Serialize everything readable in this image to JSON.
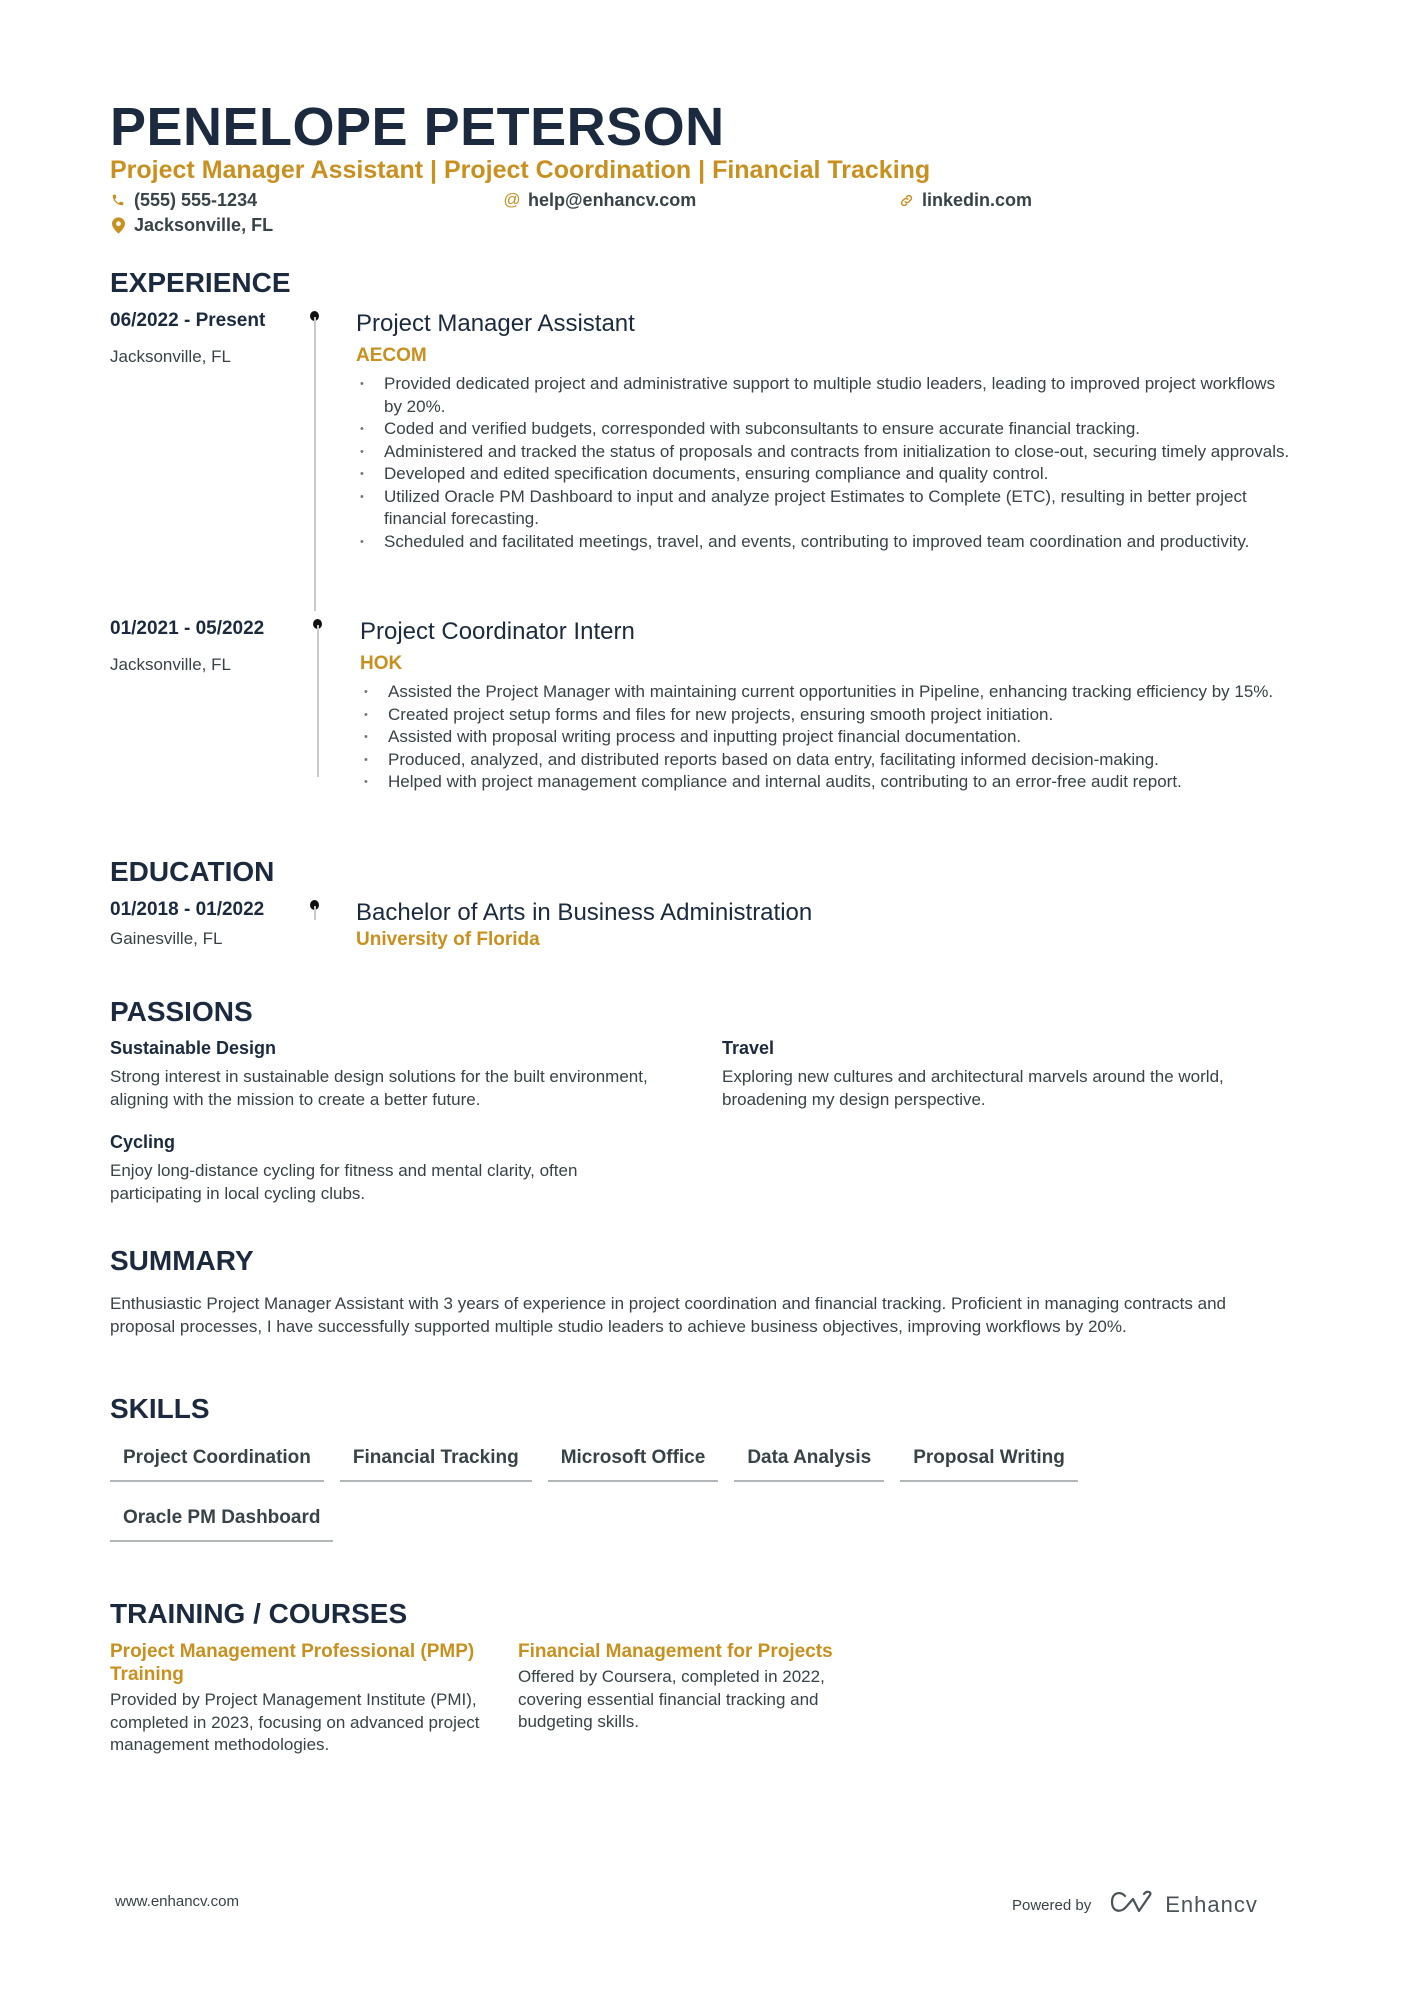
{
  "header": {
    "name": "PENELOPE PETERSON",
    "headline": "Project Manager Assistant | Project Coordination | Financial Tracking",
    "contacts": {
      "phone": {
        "icon": "phone-icon",
        "value": "(555) 555-1234"
      },
      "email": {
        "icon": "at-icon",
        "value": "help@enhancv.com"
      },
      "link": {
        "icon": "link-icon",
        "value": "linkedin.com"
      },
      "location": {
        "icon": "map-pin-icon",
        "value": "Jacksonville, FL"
      }
    }
  },
  "colors": {
    "accent": "#c9901f",
    "heading": "#1b2a3e",
    "body": "#384347"
  },
  "sections": {
    "experience": "EXPERIENCE",
    "education": "EDUCATION",
    "passions": "PASSIONS",
    "summary": "SUMMARY",
    "skills": "SKILLS",
    "training": "TRAINING / COURSES"
  },
  "experience": [
    {
      "date": "06/2022 - Present",
      "location": "Jacksonville, FL",
      "role": "Project Manager Assistant",
      "company": "AECOM",
      "bullets": [
        "Provided dedicated project and administrative support to multiple studio leaders, leading to improved project workflows by 20%.",
        "Coded and verified budgets, corresponded with subconsultants to ensure accurate financial tracking.",
        "Administered and tracked the status of proposals and contracts from initialization to close-out, securing timely approvals.",
        "Developed and edited specification documents, ensuring compliance and quality control.",
        "Utilized Oracle PM Dashboard to input and analyze project Estimates to Complete (ETC), resulting in better project financial forecasting.",
        "Scheduled and facilitated meetings, travel, and events, contributing to improved team coordination and productivity."
      ]
    },
    {
      "date": "01/2021 - 05/2022",
      "location": "Jacksonville, FL",
      "role": "Project Coordinator Intern",
      "company": "HOK",
      "bullets": [
        "Assisted the Project Manager with maintaining current opportunities in Pipeline, enhancing tracking efficiency by 15%.",
        "Created project setup forms and files for new projects, ensuring smooth project initiation.",
        "Assisted with proposal writing process and inputting project financial documentation.",
        "Produced, analyzed, and distributed reports based on data entry, facilitating informed decision-making.",
        "Helped with project management compliance and internal audits, contributing to an error-free audit report."
      ]
    }
  ],
  "education": [
    {
      "date": "01/2018 - 01/2022",
      "location": "Gainesville, FL",
      "degree": "Bachelor of Arts in Business Administration",
      "school": "University of Florida"
    }
  ],
  "passions": [
    {
      "title": "Sustainable Design",
      "description": "Strong interest in sustainable design solutions for the built environment, aligning with the mission to create a better future."
    },
    {
      "title": "Travel",
      "description": "Exploring new cultures and architectural marvels around the world, broadening my design perspective."
    },
    {
      "title": "Cycling",
      "description": "Enjoy long-distance cycling for fitness and mental clarity, often participating in local cycling clubs."
    }
  ],
  "summary": "Enthusiastic Project Manager Assistant with 3 years of experience in project coordination and financial tracking. Proficient in managing contracts and proposal processes, I have successfully supported multiple studio leaders to achieve business objectives, improving workflows by 20%.",
  "skills": [
    "Project Coordination",
    "Financial Tracking",
    "Microsoft Office",
    "Data Analysis",
    "Proposal Writing",
    "Oracle PM Dashboard"
  ],
  "training": [
    {
      "title": "Project Management Professional (PMP) Training",
      "description": "Provided by Project Management Institute (PMI), completed in 2023, focusing on advanced project management methodologies."
    },
    {
      "title": "Financial Management for Projects",
      "description": "Offered by Coursera, completed in 2022, covering essential financial tracking and budgeting skills."
    }
  ],
  "footer": {
    "url": "www.enhancv.com",
    "powered_by": "Powered by",
    "brand": "Enhancv"
  }
}
